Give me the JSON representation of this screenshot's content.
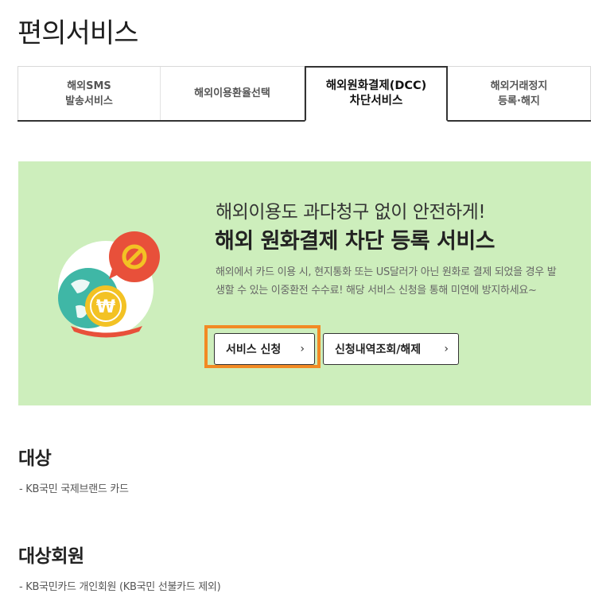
{
  "page": {
    "title": "편의서비스"
  },
  "tabs": [
    {
      "label": "해외SMS\n발송서비스",
      "active": false
    },
    {
      "label": "해외이용환율선택",
      "active": false
    },
    {
      "label": "해외원화결제(DCC)\n차단서비스",
      "active": true
    },
    {
      "label": "해외거래정지\n등록·해지",
      "active": false
    }
  ],
  "banner": {
    "subtitle": "해외이용도 과다청구 없이 안전하게!",
    "title": "해외 원화결제 차단 등록 서비스",
    "description": "해외에서 카드 이용 시, 현지통화 또는 US달러가 아닌 원화로 결제 되었을 경우 발생할 수 있는 이중환전 수수료! 해당 서비스 신청을 통해 미연에 방지하세요~",
    "illustration_symbol": "₩",
    "buttons": {
      "apply": "서비스 신청",
      "inquiry": "신청내역조회/해제",
      "chevron": "›"
    }
  },
  "sections": {
    "target": {
      "title": "대상",
      "text": "- KB국민 국제브랜드 카드"
    },
    "members": {
      "title": "대상회원",
      "text": "- KB국민카드 개인회원 (KB국민 선불카드 제외)"
    }
  },
  "colors": {
    "banner_bg": "#cdeebc",
    "highlight": "#f28a24",
    "ban_red": "#e8503a",
    "coin_yellow": "#f3c224",
    "globe_teal": "#3fb7a6"
  },
  "icons": [
    "ban-icon",
    "globe-icon",
    "won-coin-icon"
  ]
}
